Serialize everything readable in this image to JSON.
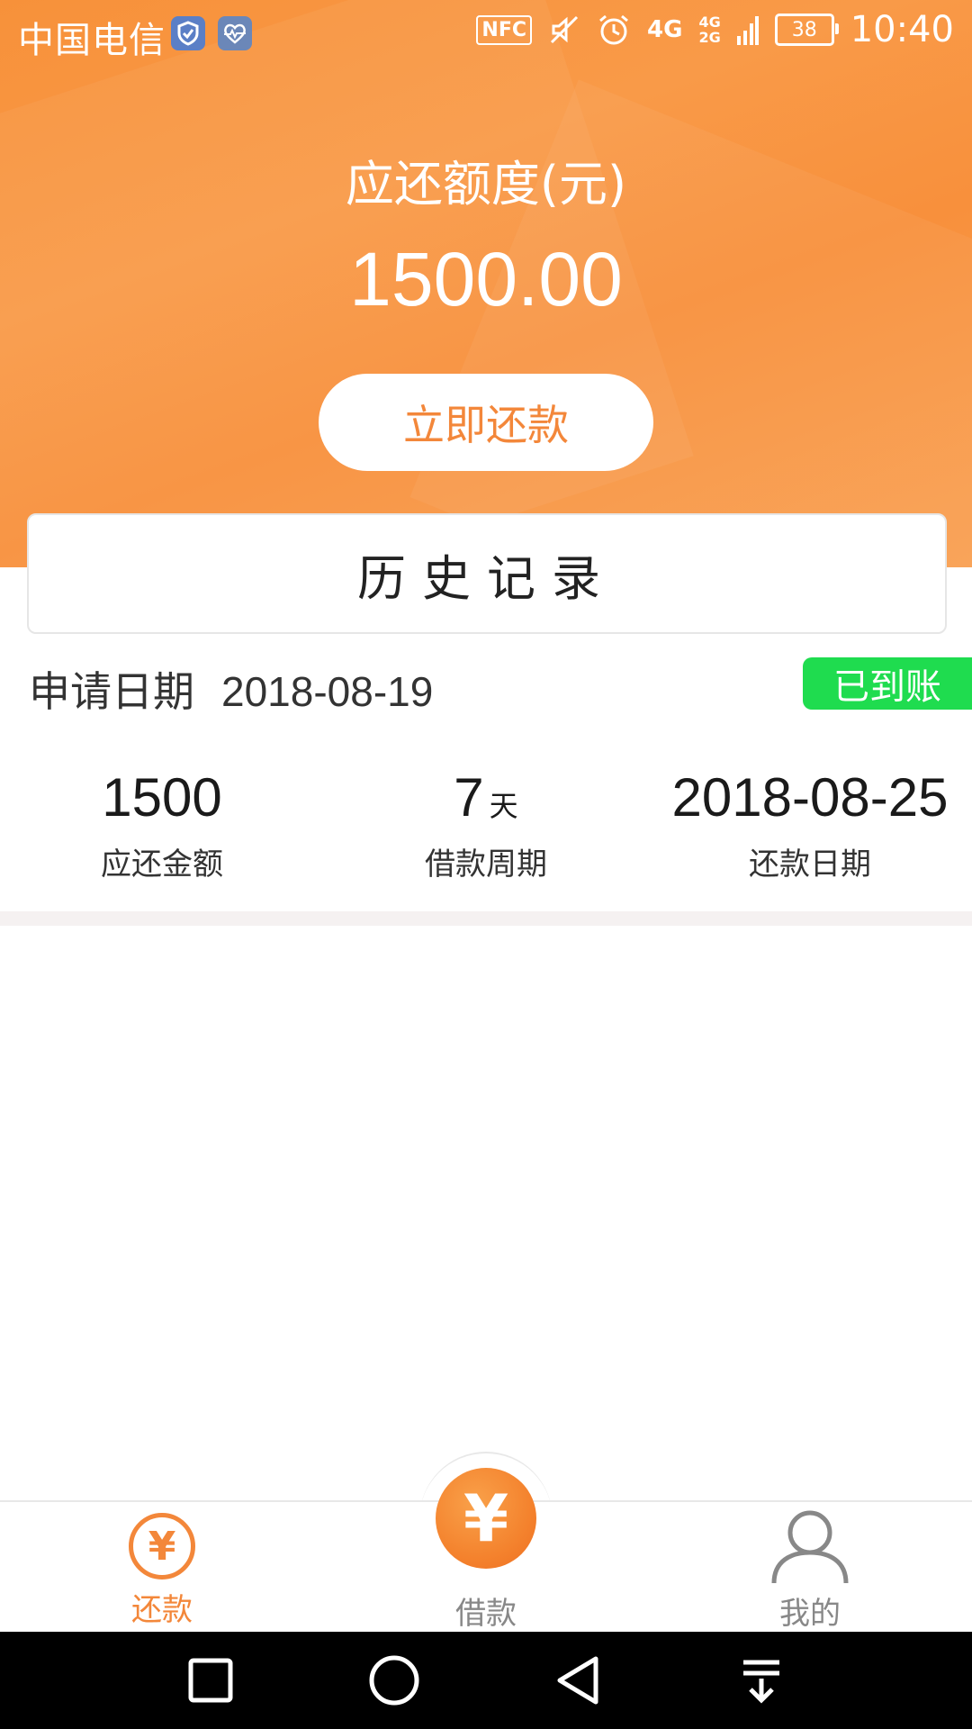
{
  "status_bar": {
    "carrier": "中国电信",
    "nfc": "NFC",
    "net_primary": "4G",
    "net_secondary_top": "4G",
    "net_secondary_bottom": "2G",
    "battery": "38",
    "time": "10:40"
  },
  "header": {
    "quota_label": "应还额度(元)",
    "quota_amount": "1500.00",
    "repay_button": "立即还款"
  },
  "history": {
    "title": "历史记录"
  },
  "record": {
    "apply_label": "申请日期",
    "apply_date": "2018-08-19",
    "status": "已到账",
    "stats": [
      {
        "value": "1500",
        "unit": "",
        "label": "应还金额"
      },
      {
        "value": "7",
        "unit": "天",
        "label": "借款周期"
      },
      {
        "value": "2018-08-25",
        "unit": "",
        "label": "还款日期"
      }
    ]
  },
  "tabs": {
    "repay": "还款",
    "borrow": "借款",
    "mine": "我的"
  },
  "icons": {
    "repay_tab": "yuan-circle-icon",
    "borrow_tab": "yuan-filled-icon",
    "mine_tab": "user-icon",
    "yuan_glyph": "¥"
  },
  "colors": {
    "accent": "#f3873a",
    "status_green": "#1fdc4f"
  }
}
